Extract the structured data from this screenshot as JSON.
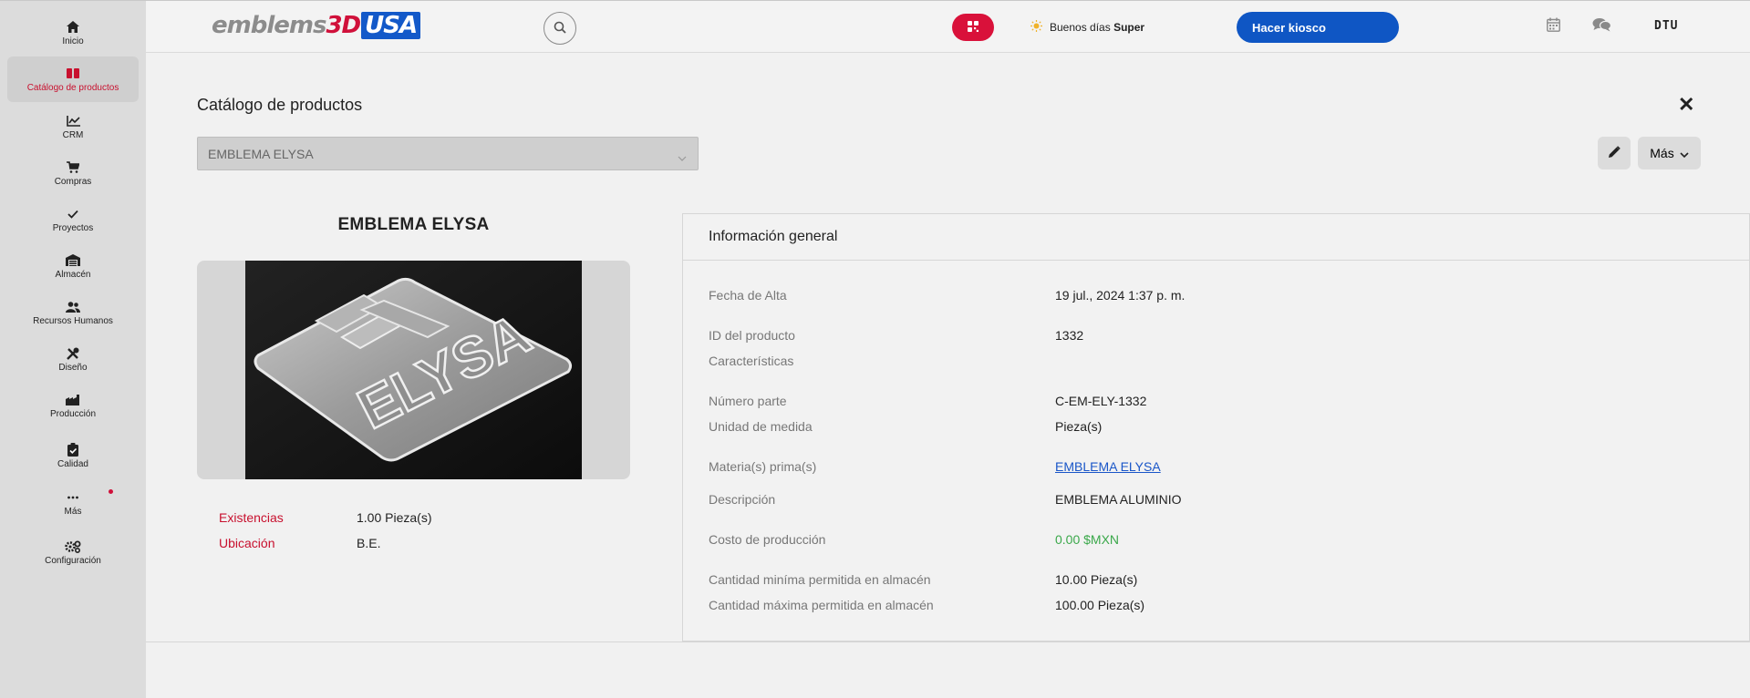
{
  "sidebar": {
    "items": [
      {
        "label": "Inicio",
        "icon": "home-icon"
      },
      {
        "label": "Catálogo de productos",
        "icon": "book-icon"
      },
      {
        "label": "CRM",
        "icon": "chart-line-icon"
      },
      {
        "label": "Compras",
        "icon": "cart-icon"
      },
      {
        "label": "Proyectos",
        "icon": "check-icon"
      },
      {
        "label": "Almacén",
        "icon": "warehouse-icon"
      },
      {
        "label": "Recursos Humanos",
        "icon": "users-icon"
      },
      {
        "label": "Diseño",
        "icon": "tools-icon"
      },
      {
        "label": "Producción",
        "icon": "factory-icon"
      },
      {
        "label": "Calidad",
        "icon": "clipboard-check-icon"
      },
      {
        "label": "Más",
        "icon": "ellipsis-icon"
      },
      {
        "label": "Configuración",
        "icon": "gears-icon"
      }
    ]
  },
  "header": {
    "logo": {
      "part1": "emblems",
      "part2": "3D",
      "part3": "USA"
    },
    "greeting": "Buenos días",
    "user": "Super",
    "kiosk_label": "Hacer kiosco",
    "user_initials": "DTU"
  },
  "page": {
    "title": "Catálogo de productos",
    "close": "✕",
    "selector_value": "EMBLEMA ELYSA",
    "more_label": "Más"
  },
  "product": {
    "name": "EMBLEMA ELYSA",
    "image_text": "ELYSA",
    "stock": [
      {
        "label": "Existencias",
        "value": "1.00 Pieza(s)"
      },
      {
        "label": "Ubicación",
        "value": "B.E."
      }
    ]
  },
  "info": {
    "title": "Información general",
    "rows": [
      {
        "label": "Fecha de Alta",
        "value": "19 jul., 2024 1:37 p. m."
      },
      {
        "label": "ID del producto",
        "value": "1332"
      },
      {
        "label": "Características",
        "value": ""
      },
      {
        "label": "Número parte",
        "value": "C-EM-ELY-1332"
      },
      {
        "label": "Unidad de medida",
        "value": "Pieza(s)"
      },
      {
        "label": "Materia(s) prima(s)",
        "value": "EMBLEMA ELYSA"
      },
      {
        "label": "Descripción",
        "value": "EMBLEMA ALUMINIO"
      },
      {
        "label": "Costo de producción",
        "value": "0.00 $MXN"
      },
      {
        "label": "Cantidad miníma permitida en almacén",
        "value": "10.00 Pieza(s)"
      },
      {
        "label": "Cantidad máxima permitida en almacén",
        "value": "100.00 Pieza(s)"
      }
    ]
  },
  "colors": {
    "accent_red": "#d0103a",
    "primary_blue": "#0f56c4",
    "link_blue": "#1a56c8",
    "cost_green": "#3aa84a"
  }
}
